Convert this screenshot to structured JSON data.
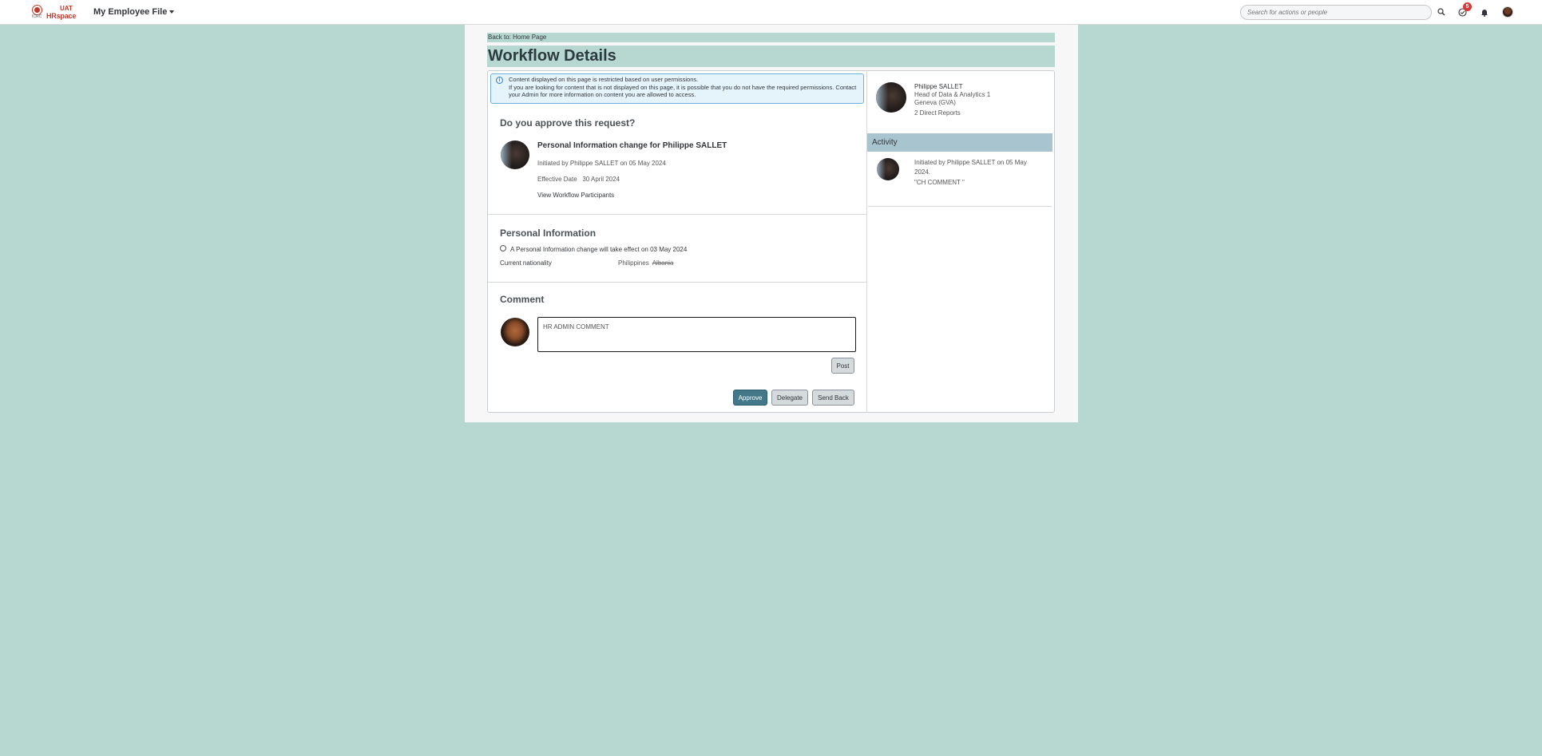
{
  "topbar": {
    "logo_org": "ICRC",
    "logo_env": "UAT",
    "logo_app": "HRspace",
    "app_title": "My Employee File",
    "search_placeholder": "Search for actions or people",
    "notifications_badge": "5"
  },
  "page": {
    "back_link": "Back to: Home Page",
    "title": "Workflow Details"
  },
  "info_banner": {
    "line1": "Content displayed on this page is restricted based on user permissions.",
    "line2": "If you are looking for content that is not displayed on this page, it is possible that you do not have the required permissions. Contact your Admin for more information on content you are allowed to access."
  },
  "request": {
    "heading": "Do you approve this request?",
    "title": "Personal Information change for Philippe SALLET",
    "initiated": "Initiated by Philippe SALLET on 05 May 2024",
    "effective_label": "Effective Date",
    "effective_value": "30 April 2024",
    "participants_link": "View Workflow Participants"
  },
  "personal_info": {
    "heading": "Personal Information",
    "notice": "A Personal Information change will take effect on 03 May 2024",
    "field_label": "Current nationality",
    "new_value": "Philippines",
    "old_value": "Albania"
  },
  "comment": {
    "heading": "Comment",
    "value": "HR ADMIN COMMENT",
    "post_label": "Post"
  },
  "actions": {
    "approve": "Approve",
    "delegate": "Delegate",
    "send_back": "Send Back"
  },
  "sidebar": {
    "person_name": "Philippe SALLET",
    "person_title": "Head of Data & Analytics 1",
    "person_location": "Geneva (GVA)",
    "direct_reports": "2 Direct Reports",
    "activity_heading": "Activity",
    "activity_line1": "Initiated by Philippe SALLET on 05 May",
    "activity_line2": "2024.",
    "activity_comment": "\"CH COMMENT \""
  },
  "colors": {
    "background": "#b7d8d1",
    "primary_button": "#427888",
    "activity_header": "#a8c5cf",
    "info_border": "#6fb0de",
    "badge": "#d9383a"
  }
}
